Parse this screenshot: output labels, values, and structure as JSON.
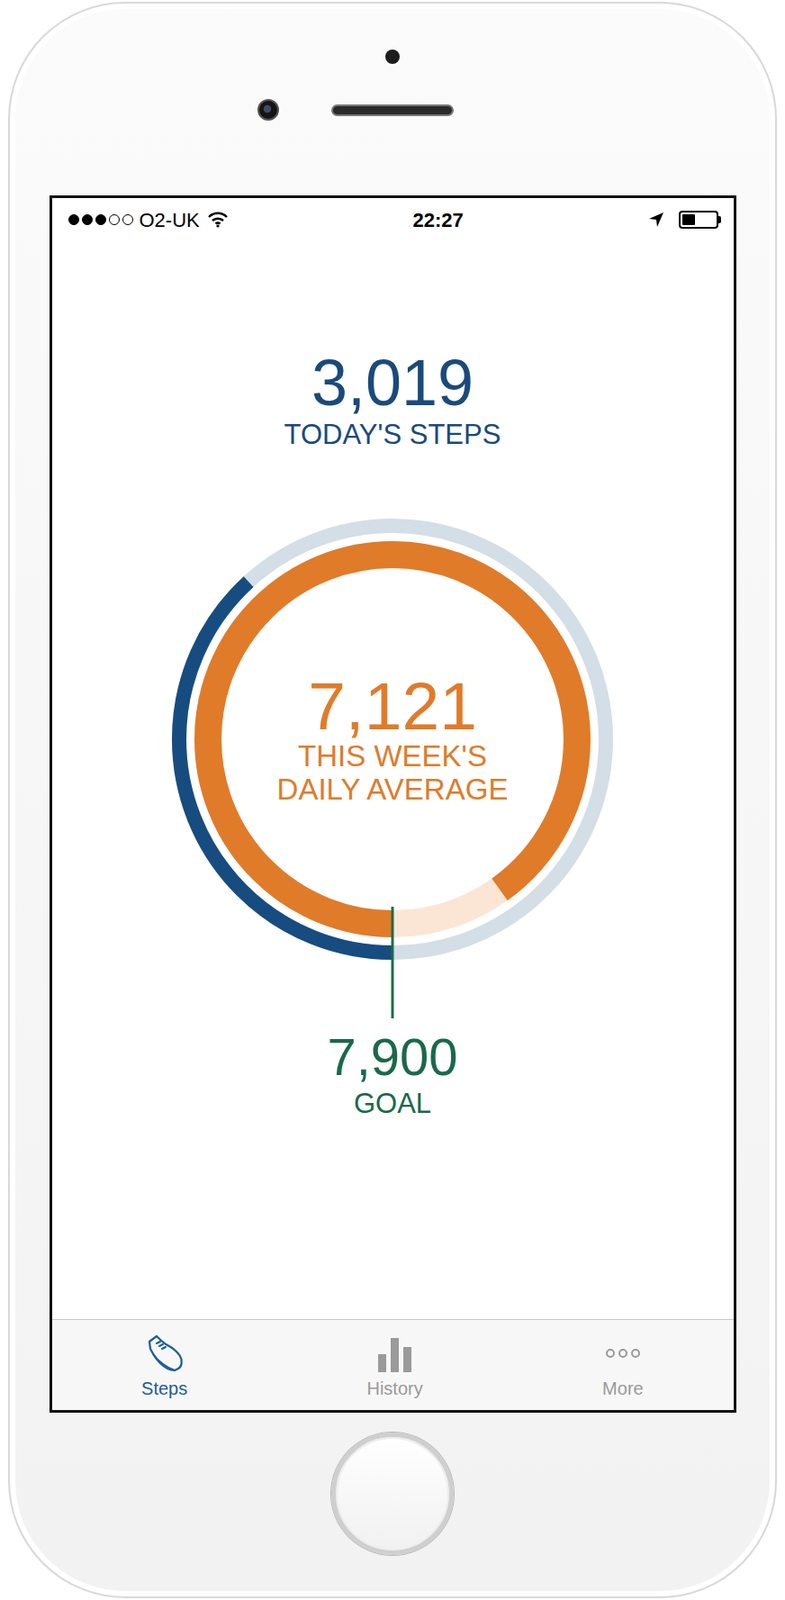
{
  "status_bar": {
    "carrier": "O2-UK",
    "signal_level": 0.6,
    "time": "22:27",
    "battery_level": 0.4
  },
  "today": {
    "value": "3,019",
    "label": "TODAY'S STEPS",
    "level": 0.382
  },
  "average": {
    "value": "7,121",
    "label_lines": [
      "THIS WEEK'S",
      "DAILY AVERAGE"
    ],
    "level": 0.901
  },
  "goal": {
    "value": "7,900",
    "label": "GOAL"
  },
  "tabs": [
    {
      "label": "Steps",
      "selected": true
    },
    {
      "label": "History",
      "selected": false
    },
    {
      "label": "More",
      "selected": false
    }
  ]
}
